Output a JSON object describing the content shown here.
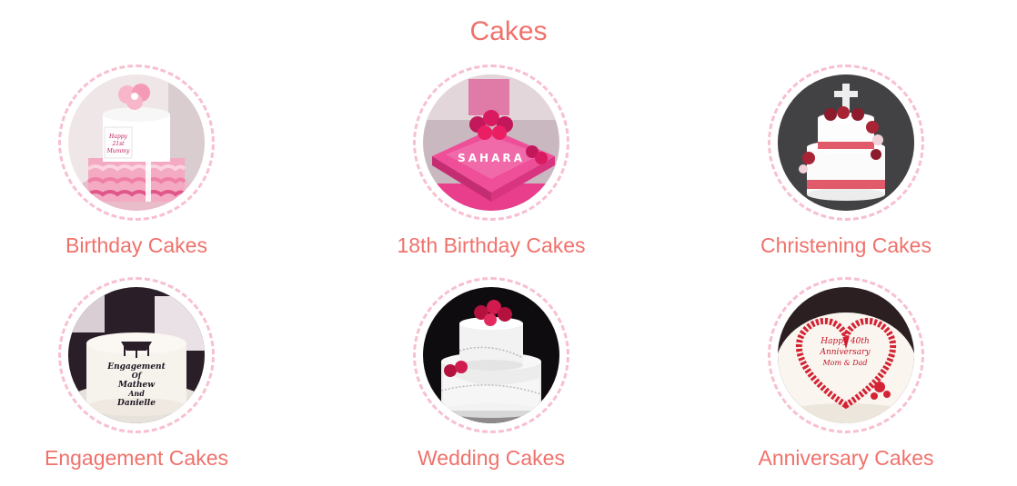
{
  "section": {
    "title": "Cakes"
  },
  "categories": [
    {
      "label": "Birthday Cakes",
      "image_icon": "birthday-cake-photo",
      "cake_text": [
        "Happy",
        "21st",
        "Mummy"
      ]
    },
    {
      "label": "18th Birthday Cakes",
      "image_icon": "18th-birthday-cake-photo",
      "cake_text": [
        "SAHARA"
      ]
    },
    {
      "label": "Christening Cakes",
      "image_icon": "christening-cake-photo",
      "cake_text": []
    },
    {
      "label": "Engagement Cakes",
      "image_icon": "engagement-cake-photo",
      "cake_text": [
        "Engagement",
        "Of",
        "Mathew",
        "And",
        "Danielle"
      ]
    },
    {
      "label": "Wedding Cakes",
      "image_icon": "wedding-cake-photo",
      "cake_text": []
    },
    {
      "label": "Anniversary Cakes",
      "image_icon": "anniversary-cake-photo",
      "cake_text": [
        "Happy 40th",
        "Anniversary",
        "Mom & Dad"
      ]
    }
  ],
  "colors": {
    "accent": "#f0716b",
    "ring": "#f8c0cf",
    "background": "#ffffff"
  }
}
